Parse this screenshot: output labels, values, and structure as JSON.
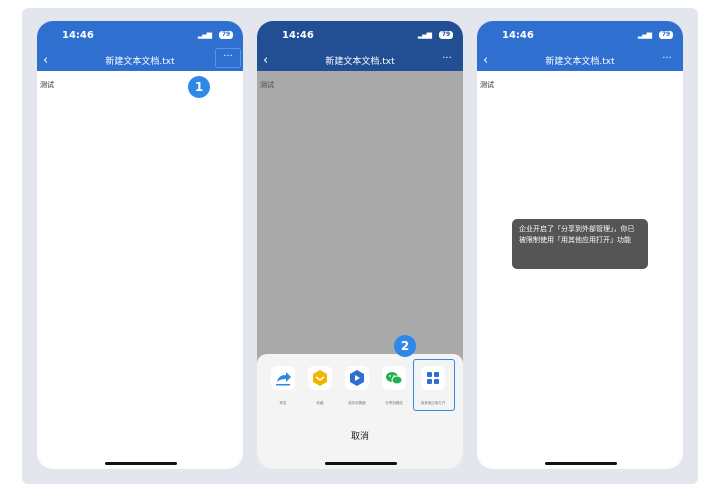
{
  "status": {
    "time": "14:46",
    "battery": "79"
  },
  "file_title": "新建文本文档.txt",
  "icons": {
    "back": "‹",
    "more": "···"
  },
  "phone1": {
    "content": "测试",
    "step_badge": "1"
  },
  "phone2": {
    "content": "测试",
    "step_badge": "2",
    "share_items": [
      {
        "label": "转发",
        "icon": "forward-icon"
      },
      {
        "label": "收藏",
        "icon": "favorite-icon"
      },
      {
        "label": "保存到微盘",
        "icon": "drive-icon"
      },
      {
        "label": "分享到微信",
        "icon": "wechat-icon"
      },
      {
        "label": "用其他应用打开",
        "icon": "other-apps-icon"
      }
    ],
    "cancel_label": "取消"
  },
  "phone3": {
    "content": "测试",
    "toast": "企业开启了「分享到外部管理」，你已被限制使用「用其他应用打开」功能"
  }
}
